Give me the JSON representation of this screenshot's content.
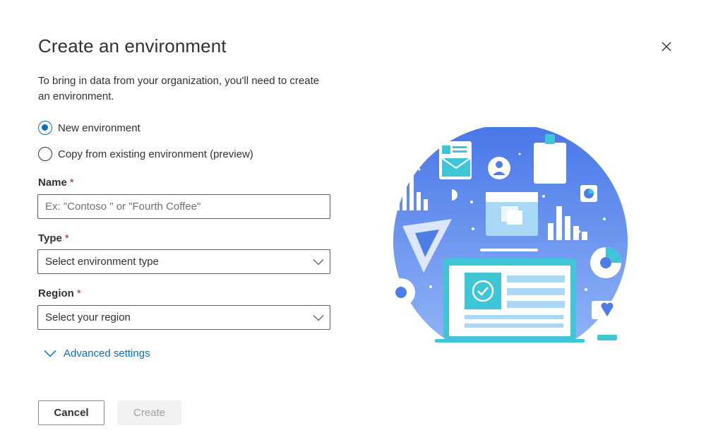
{
  "dialog": {
    "title": "Create an environment",
    "description": "To bring in data from your organization, you'll need to create an environment.",
    "close_icon": "close-icon"
  },
  "options": {
    "new_environment": "New environment",
    "copy_environment": "Copy from existing environment (preview)",
    "selected": "new_environment"
  },
  "form": {
    "name_label": "Name",
    "name_placeholder": "Ex: \"Contoso \" or \"Fourth Coffee\"",
    "name_value": "",
    "type_label": "Type",
    "type_value": "Select environment type",
    "region_label": "Region",
    "region_value": "Select your region",
    "required_marker": "*"
  },
  "advanced": {
    "label": "Advanced settings",
    "icon": "chevron-down-icon"
  },
  "buttons": {
    "cancel": "Cancel",
    "create": "Create"
  },
  "colors": {
    "accent": "#0f6cbd",
    "required": "#a4262c",
    "illustration_blue": "#4f7de8",
    "illustration_teal": "#3fc6d6"
  }
}
